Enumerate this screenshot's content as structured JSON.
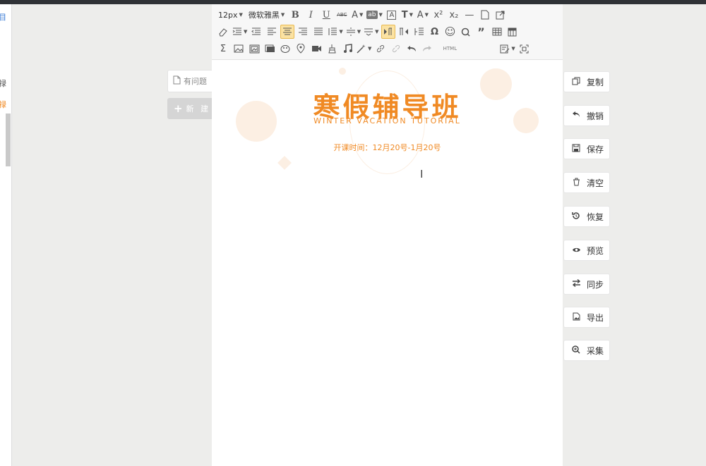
{
  "left_panel": {
    "glyph_1": "目",
    "glyph_2": "禄",
    "glyph_3": "禄"
  },
  "side_tabs": {
    "question_label": "有问题",
    "new_label": "新 建",
    "new_icon": "+"
  },
  "toolbar": {
    "font_size": "12px",
    "font_family": "微软雅黑",
    "row1": [
      "B",
      "I",
      "U",
      "ABC",
      "A",
      "ab",
      "A",
      "T",
      "A",
      "x²",
      "x₂",
      "—",
      "▢",
      "⤢"
    ],
    "row2": [
      "eraser-icon",
      "indent-icon",
      "outdent-icon",
      "align-left-icon",
      "align-center-icon",
      "align-right-icon",
      "align-justify-icon",
      "line-height-icon",
      "para-spacing-icon",
      "row-spacing-icon",
      "ltr-icon",
      "rtl-icon",
      "format-icon",
      "Ω",
      "☺",
      "search-icon",
      "”",
      "table-icon",
      "table-props-icon"
    ],
    "row3": [
      "Σ",
      "image-icon",
      "multi-image-icon",
      "frame-icon",
      "scrawl-icon",
      "map-icon",
      "video-icon",
      "brush-icon",
      "music-icon",
      "magic-icon",
      "link-icon",
      "unlink-icon",
      "undo-icon",
      "redo-icon",
      "HTML",
      "edit-icon",
      "fullscreen-icon"
    ]
  },
  "document": {
    "title": "寒假辅导班",
    "subtitle": "WINTER VACATION TUTORIAL",
    "date_line": "开课时间：12月20号-1月20号"
  },
  "actions": [
    {
      "label": "复制",
      "icon": "copy-icon"
    },
    {
      "label": "撤销",
      "icon": "undo-icon"
    },
    {
      "label": "保存",
      "icon": "save-icon"
    },
    {
      "label": "清空",
      "icon": "trash-icon"
    },
    {
      "label": "恢复",
      "icon": "restore-icon"
    },
    {
      "label": "预览",
      "icon": "eye-icon"
    },
    {
      "label": "同步",
      "icon": "sync-icon"
    },
    {
      "label": "导出",
      "icon": "export-icon"
    },
    {
      "label": "采集",
      "icon": "collect-icon"
    }
  ],
  "colors": {
    "accent": "#f08a24",
    "active_tool": "#fbe2a2",
    "deco": "#fcefe3"
  }
}
